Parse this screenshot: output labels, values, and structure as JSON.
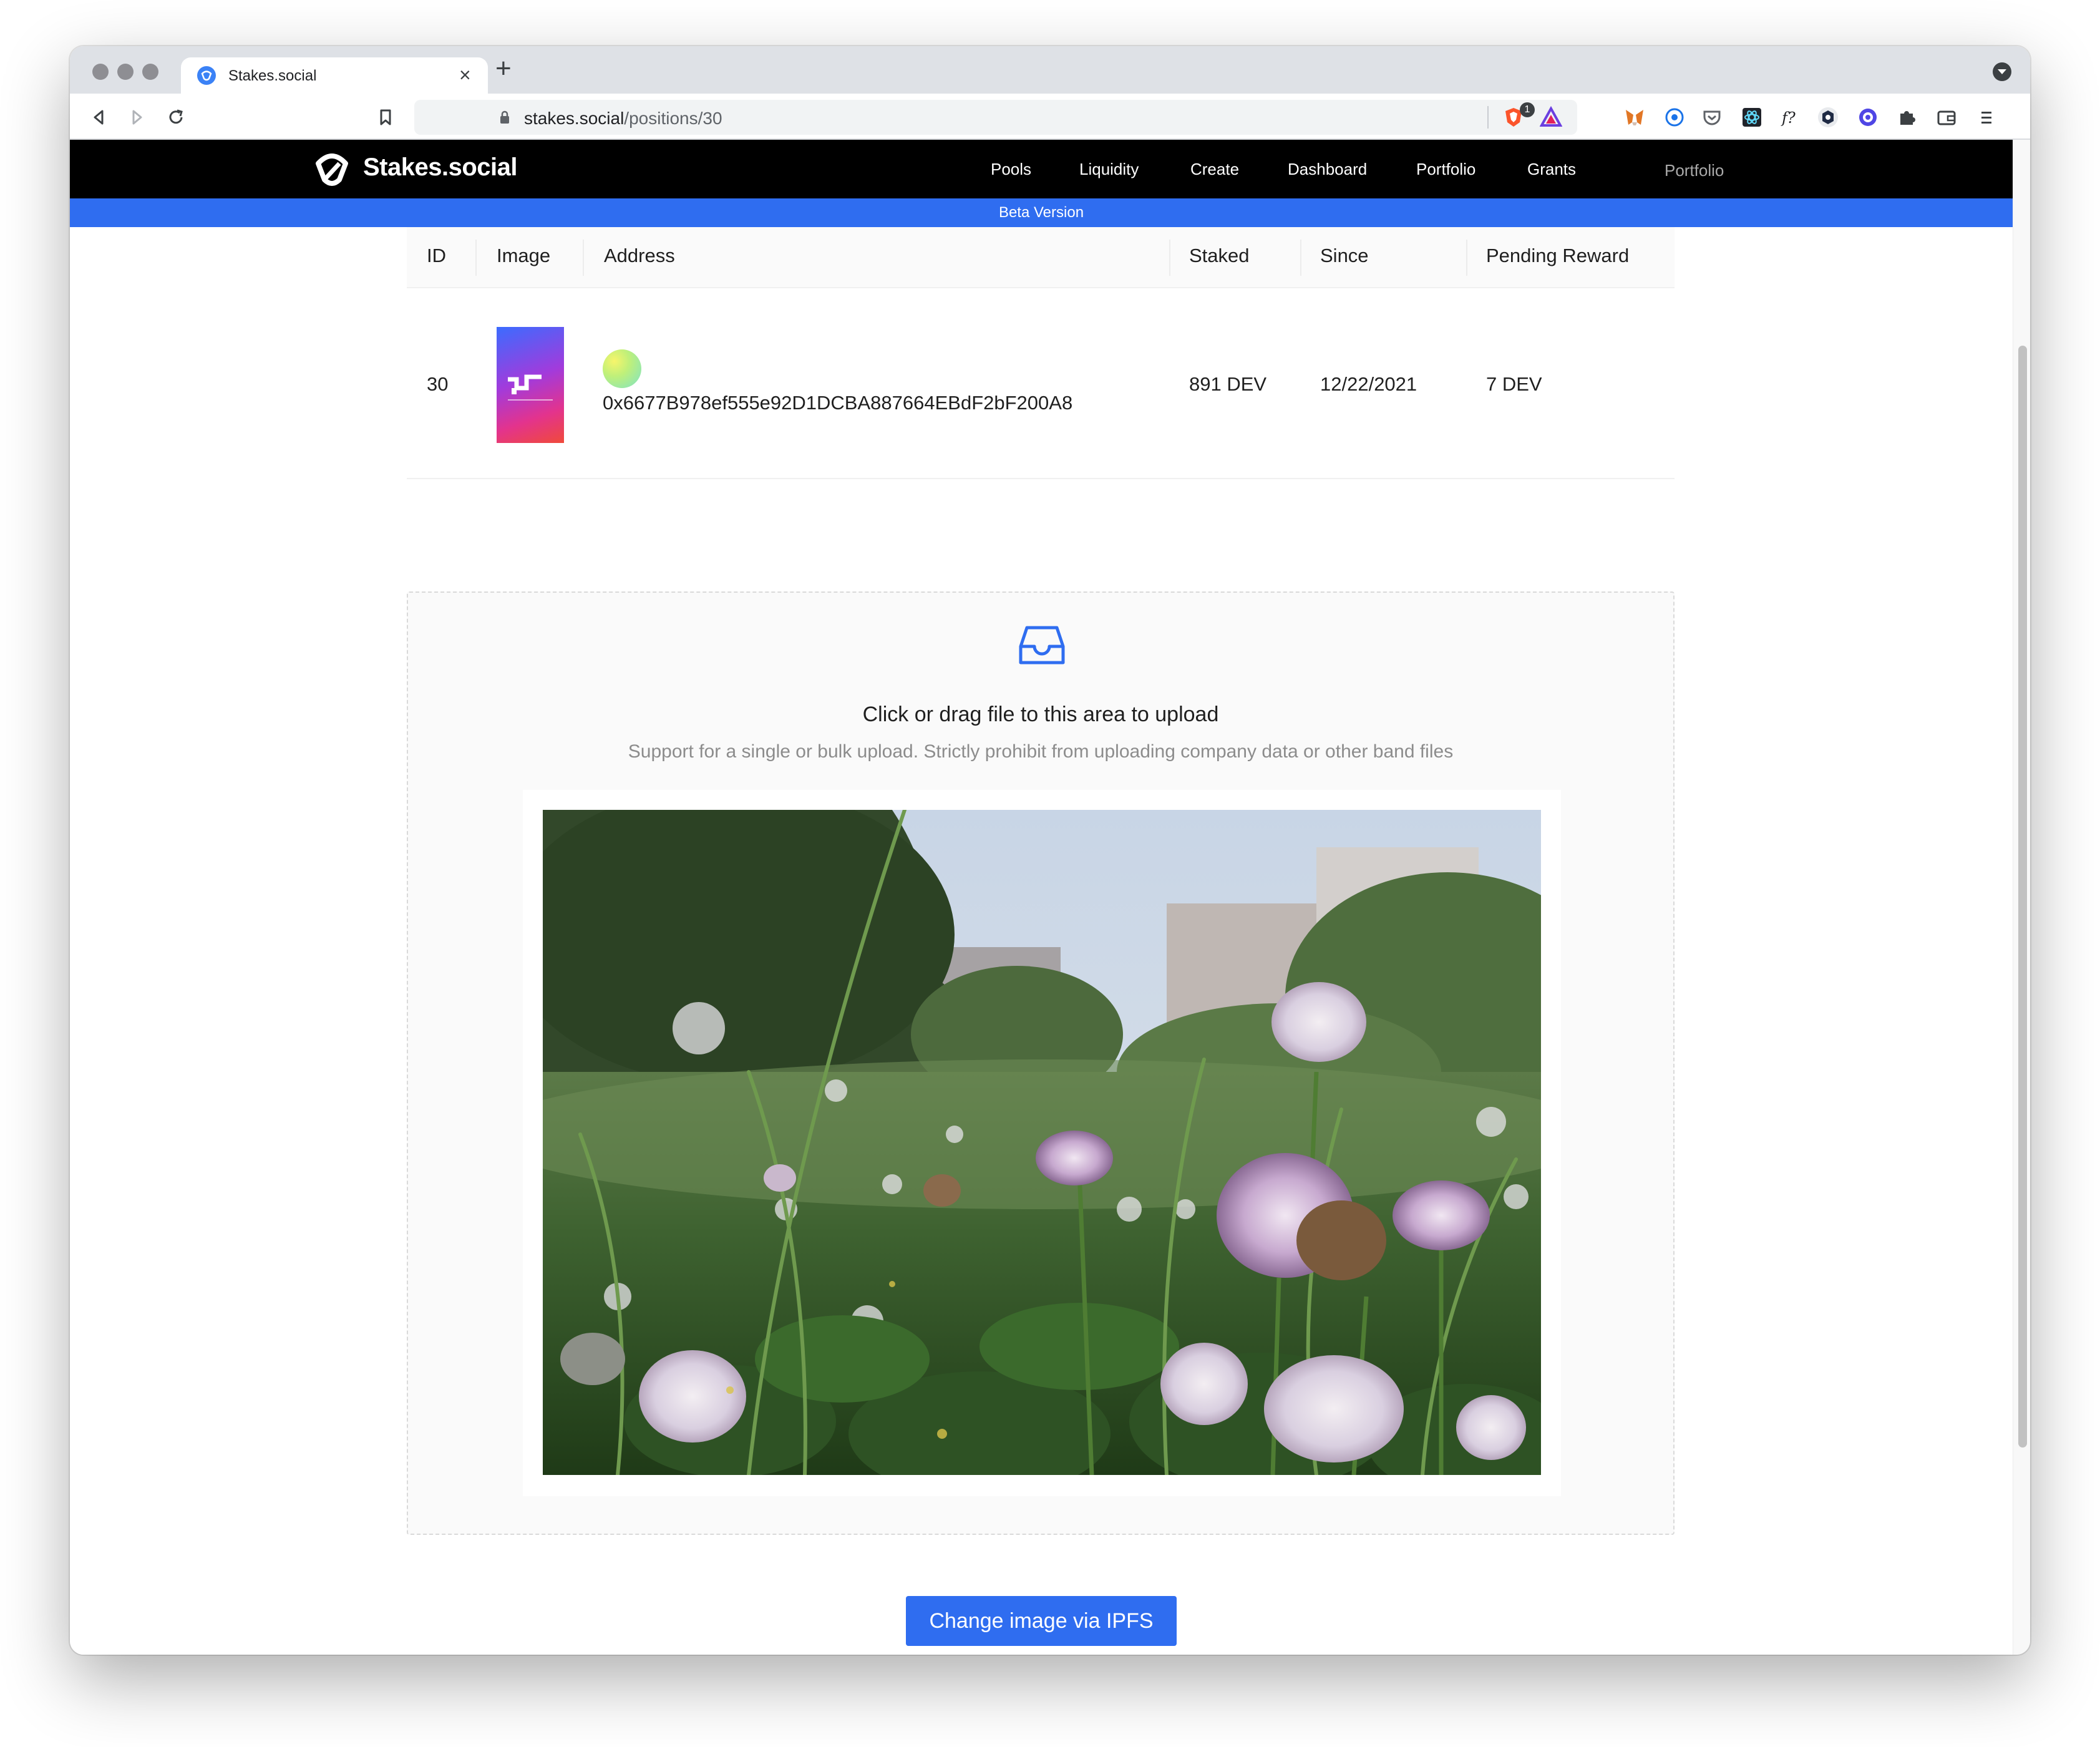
{
  "browser": {
    "tab_title": "Stakes.social",
    "url_domain": "stakes.social",
    "url_path": "/positions/30",
    "brave_badge": "1"
  },
  "site": {
    "logo_text": "Stakes.social",
    "nav": [
      "Pools",
      "Liquidity",
      "Create",
      "Dashboard",
      "Portfolio",
      "Grants"
    ],
    "nav_account": "Portfolio",
    "beta_label": "Beta Version"
  },
  "table": {
    "headers": [
      "ID",
      "Image",
      "Address",
      "Staked",
      "Since",
      "Pending Reward"
    ],
    "row": {
      "id": "30",
      "address": "0x6677B978ef555e92D1DCBA887664EBdF2bF200A8",
      "staked": "891 DEV",
      "since": "12/22/2021",
      "pending_reward": "7 DEV"
    }
  },
  "upload": {
    "title": "Click or drag file to this area to upload",
    "hint": "Support for a single or bulk upload. Strictly prohibit from uploading company data or other band files",
    "preview_subject": "clover-flowers-photo"
  },
  "actions": {
    "change_image_label": "Change image via IPFS"
  },
  "colors": {
    "accent": "#2f6df0",
    "header_bg": "#000000"
  }
}
